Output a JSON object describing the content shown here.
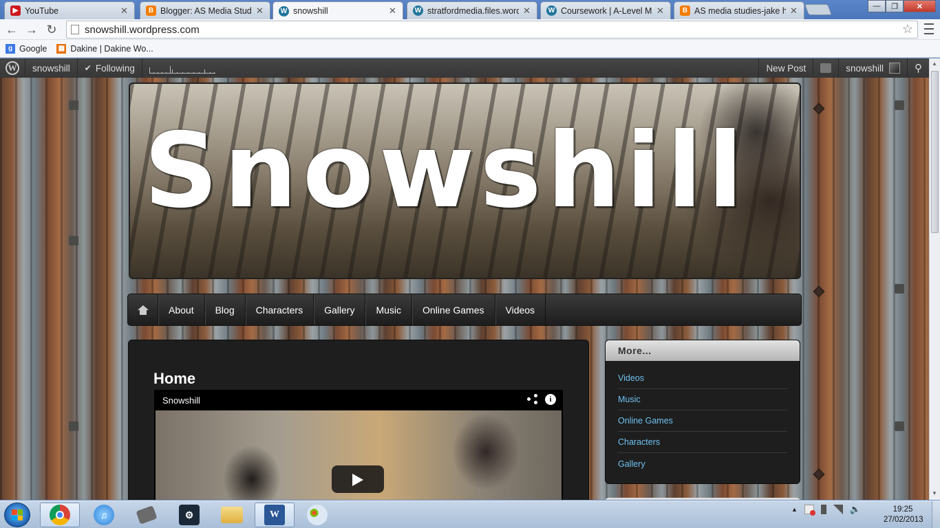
{
  "browser": {
    "tabs": [
      {
        "title": "YouTube",
        "icon": "youtube-icon",
        "color": "#cc181e",
        "active": false
      },
      {
        "title": "Blogger: AS Media Studies",
        "icon": "blogger-icon",
        "color": "#f57d00",
        "active": false
      },
      {
        "title": "snowshill",
        "icon": "wordpress-icon",
        "color": "#21759b",
        "active": true
      },
      {
        "title": "stratfordmedia.files.wordp",
        "icon": "wordpress-icon",
        "color": "#21759b",
        "active": false
      },
      {
        "title": "Coursework | A-Level Med",
        "icon": "wordpress-icon",
        "color": "#21759b",
        "active": false
      },
      {
        "title": "AS media studies-jake has",
        "icon": "blogger-icon",
        "color": "#f57d00",
        "active": false
      }
    ],
    "url": "snowshill.wordpress.com",
    "bookmarks": [
      {
        "label": "Google",
        "icon": "google-icon",
        "color": "#3b78e7"
      },
      {
        "label": "Dakine | Dakine Wo...",
        "icon": "dakine-icon",
        "color": "#e8710a"
      }
    ]
  },
  "wpbar": {
    "site": "snowshill",
    "following": "Following",
    "new_post": "New Post",
    "user": "snowshill"
  },
  "site": {
    "title": "Snowshill",
    "nav": [
      "About",
      "Blog",
      "Characters",
      "Gallery",
      "Music",
      "Online Games",
      "Videos"
    ]
  },
  "content": {
    "heading": "Home",
    "video_title": "Snowshill"
  },
  "sidebar": {
    "title": "More...",
    "links": [
      "Videos",
      "Music",
      "Online Games",
      "Characters",
      "Gallery"
    ]
  },
  "taskbar": {
    "apps": [
      {
        "name": "chrome-app",
        "color": "#db4437",
        "active": true
      },
      {
        "name": "itunes-app",
        "color": "#2f7fd8",
        "active": false
      },
      {
        "name": "clapper-app",
        "color": "#6b6b6b",
        "active": false
      },
      {
        "name": "steam-app",
        "color": "#1b2838",
        "active": false
      },
      {
        "name": "explorer-app",
        "color": "#e8c25a",
        "active": false
      },
      {
        "name": "word-app",
        "color": "#2b5797",
        "active": true
      },
      {
        "name": "paint-app",
        "color": "#8fb8de",
        "active": false
      }
    ],
    "time": "19:25",
    "date": "27/02/2013"
  }
}
